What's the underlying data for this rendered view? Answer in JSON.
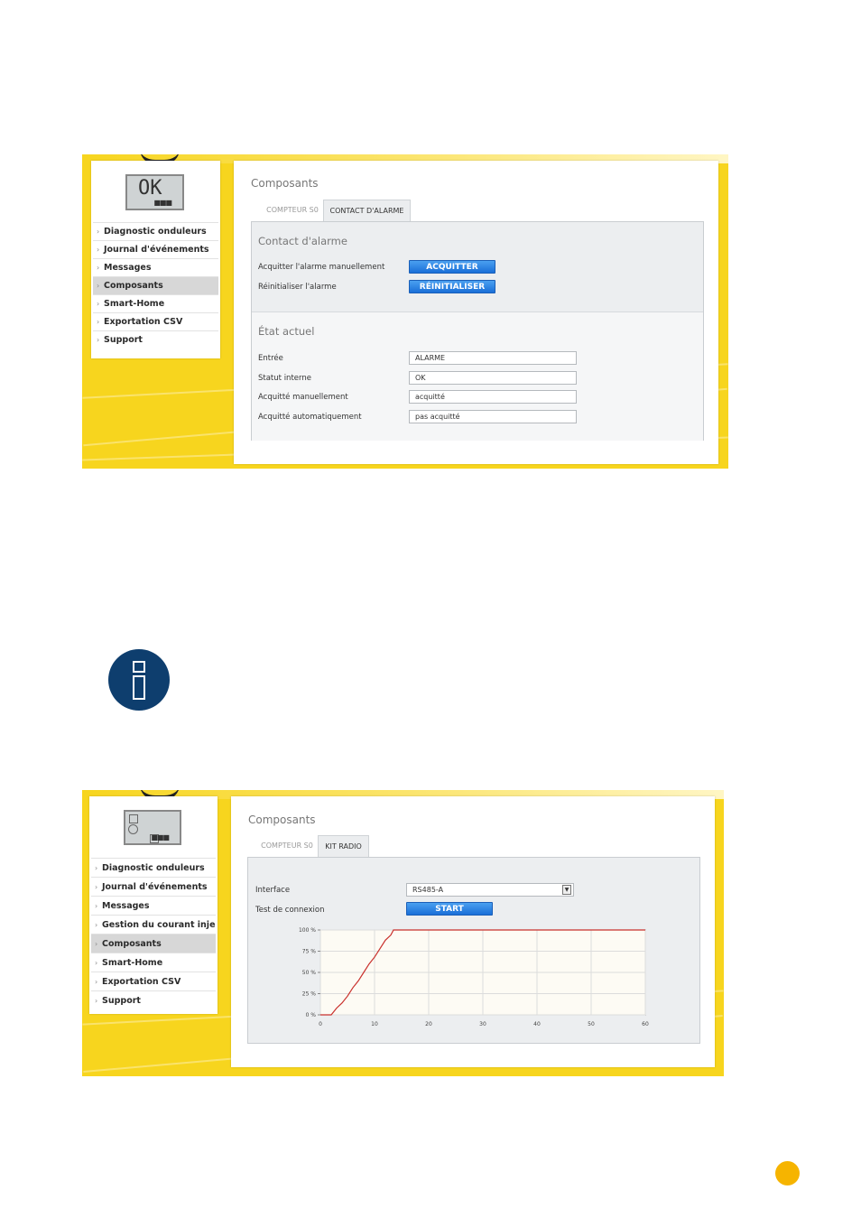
{
  "screen1": {
    "sidebar": {
      "display_text": "OK",
      "items": [
        {
          "label": "Diagnostic onduleurs"
        },
        {
          "label": "Journal d'événements"
        },
        {
          "label": "Messages"
        },
        {
          "label": "Composants"
        },
        {
          "label": "Smart-Home"
        },
        {
          "label": "Exportation CSV"
        },
        {
          "label": "Support"
        }
      ],
      "active_index": 3
    },
    "main": {
      "title": "Composants",
      "tabs": [
        {
          "label": "COMPTEUR S0"
        },
        {
          "label": "CONTACT D'ALARME"
        }
      ],
      "active_tab": 1,
      "alarm_section": {
        "title": "Contact d'alarme",
        "rows": [
          {
            "label": "Acquitter l'alarme manuellement",
            "button": "ACQUITTER"
          },
          {
            "label": "Réinitialiser l'alarme",
            "button": "RÉINITIALISER"
          }
        ]
      },
      "state_section": {
        "title": "État actuel",
        "rows": [
          {
            "label": "Entrée",
            "value": "ALARME"
          },
          {
            "label": "Statut interne",
            "value": "OK"
          },
          {
            "label": "Acquitté manuellement",
            "value": "acquitté"
          },
          {
            "label": "Acquitté automatiquement",
            "value": "pas acquitté"
          }
        ]
      }
    }
  },
  "screen2": {
    "sidebar": {
      "items": [
        {
          "label": "Diagnostic onduleurs"
        },
        {
          "label": "Journal d'événements"
        },
        {
          "label": "Messages"
        },
        {
          "label": "Gestion du courant injecté"
        },
        {
          "label": "Composants"
        },
        {
          "label": "Smart-Home"
        },
        {
          "label": "Exportation CSV"
        },
        {
          "label": "Support"
        }
      ],
      "active_index": 4
    },
    "main": {
      "title": "Composants",
      "tabs": [
        {
          "label": "COMPTEUR S0"
        },
        {
          "label": "KIT RADIO"
        }
      ],
      "active_tab": 1,
      "interface_label": "Interface",
      "interface_value": "RS485-A",
      "test_label": "Test de connexion",
      "start_button": "START"
    }
  },
  "chart_data": {
    "type": "line",
    "title": "",
    "xlabel": "",
    "ylabel": "",
    "x_ticks": [
      "0",
      "10",
      "20",
      "30",
      "40",
      "50",
      "60"
    ],
    "y_ticks": [
      "0 %",
      "25 %",
      "50 %",
      "75 %",
      "100 %"
    ],
    "xlim": [
      0,
      60
    ],
    "ylim": [
      0,
      100
    ],
    "grid": true,
    "series": [
      {
        "color": "#c9302c",
        "x": [
          0,
          2,
          3,
          4,
          5,
          6,
          7,
          8,
          9,
          10,
          11,
          12,
          13,
          13.5,
          20,
          30,
          40,
          50,
          60
        ],
        "y": [
          0,
          0,
          8,
          14,
          22,
          32,
          40,
          50,
          60,
          68,
          78,
          88,
          94,
          100,
          100,
          100,
          100,
          100,
          100
        ]
      }
    ]
  },
  "colors": {
    "brand_yellow": "#f7d51e",
    "button_blue": "#1a6fd8",
    "info_navy": "#0e3e6e",
    "page_dot": "#f6b400"
  }
}
